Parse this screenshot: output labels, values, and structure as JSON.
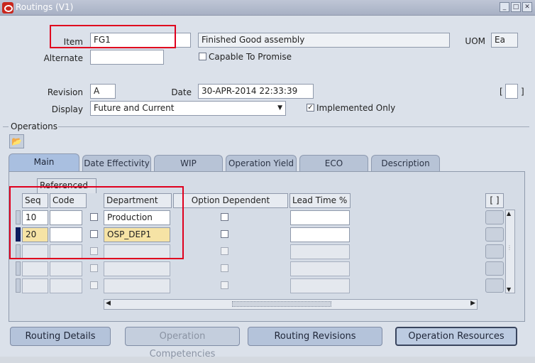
{
  "window": {
    "title": "Routings (V1)"
  },
  "header": {
    "item_label": "Item",
    "item_value": "FG1",
    "item_desc": "Finished Good assembly",
    "uom_label": "UOM",
    "uom_value": "Ea",
    "alternate_label": "Alternate",
    "alternate_value": "",
    "ctp_label": "Capable To Promise",
    "ctp_checked": false,
    "revision_label": "Revision",
    "revision_value": "A",
    "date_label": "Date",
    "date_value": "30-APR-2014 22:33:39",
    "display_label": "Display",
    "display_value": "Future and Current",
    "implemented_label": "Implemented Only",
    "implemented_checked": true,
    "bracket_field": "[ ]"
  },
  "operations": {
    "section_label": "Operations",
    "tabs": [
      {
        "label": "Main",
        "active": true
      },
      {
        "label": "Date Effectivity",
        "active": false
      },
      {
        "label": "WIP",
        "active": false
      },
      {
        "label": "Operation Yield",
        "active": false
      },
      {
        "label": "ECO",
        "active": false
      },
      {
        "label": "Description",
        "active": false
      }
    ],
    "group_header": "Referenced",
    "columns": {
      "seq": "Seq",
      "code": "Code",
      "department": "Department",
      "option_dependent": "Option Dependent",
      "lead_time": "Lead Time %",
      "context": "[ ]"
    },
    "rows": [
      {
        "seq": "10",
        "code": "",
        "referenced": false,
        "department": "Production",
        "option_dependent": false,
        "lead_time": ""
      },
      {
        "seq": "20",
        "code": "",
        "referenced": false,
        "department": "OSP_DEP1",
        "option_dependent": false,
        "lead_time": "",
        "current": true
      }
    ]
  },
  "buttons": {
    "routing_details": "Routing Details",
    "operation_competencies": "Operation Competencies",
    "routing_revisions": "Routing Revisions",
    "operation_resources": "Operation Resources"
  },
  "colors": {
    "highlight_red": "#e0001e",
    "current_field": "#f6e3a5",
    "oracle_red": "#c9261d"
  }
}
